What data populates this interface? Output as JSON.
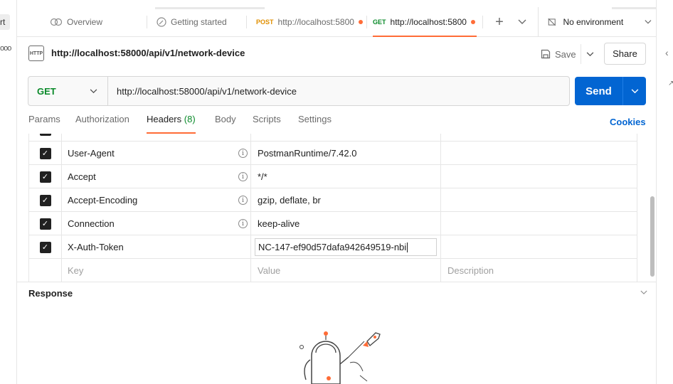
{
  "left_strip": {
    "tab_fragment": "rt",
    "more": "ooo"
  },
  "tabs": [
    {
      "label": "Overview",
      "icon": "overview-icon"
    },
    {
      "label": "Getting started",
      "icon": "getting-started-icon"
    },
    {
      "method": "POST",
      "label": "http://localhost:5800",
      "unsaved": true
    },
    {
      "method": "GET",
      "label": "http://localhost:5800",
      "unsaved": true,
      "active": true
    }
  ],
  "tabbar": {
    "add": "+",
    "more": "⌄",
    "environment": "No environment"
  },
  "request": {
    "title": "http://localhost:58000/api/v1/network-device",
    "icon_text": "HTTP",
    "save_label": "Save",
    "share_label": "Share",
    "method": "GET",
    "url": "http://localhost:58000/api/v1/network-device",
    "send_label": "Send"
  },
  "request_tabs": {
    "params": "Params",
    "authorization": "Authorization",
    "headers": "Headers",
    "headers_count": "(8)",
    "body": "Body",
    "scripts": "Scripts",
    "settings": "Settings",
    "cookies": "Cookies"
  },
  "headers": [
    {
      "key": "User-Agent",
      "value": "PostmanRuntime/7.42.0",
      "checked": true,
      "info": true
    },
    {
      "key": "Accept",
      "value": "*/*",
      "checked": true,
      "info": true
    },
    {
      "key": "Accept-Encoding",
      "value": "gzip, deflate, br",
      "checked": true,
      "info": true
    },
    {
      "key": "Connection",
      "value": "keep-alive",
      "checked": true,
      "info": true
    },
    {
      "key": "X-Auth-Token",
      "value": "NC-147-ef90d57dafa942649519-nbi",
      "checked": true,
      "info": false,
      "editing": true
    }
  ],
  "placeholders": {
    "key": "Key",
    "value": "Value",
    "description": "Description"
  },
  "response": {
    "title": "Response"
  },
  "colors": {
    "accent": "#ff6c37",
    "send": "#0265d2",
    "get": "#0a8a2a",
    "post": "#e08f00"
  }
}
